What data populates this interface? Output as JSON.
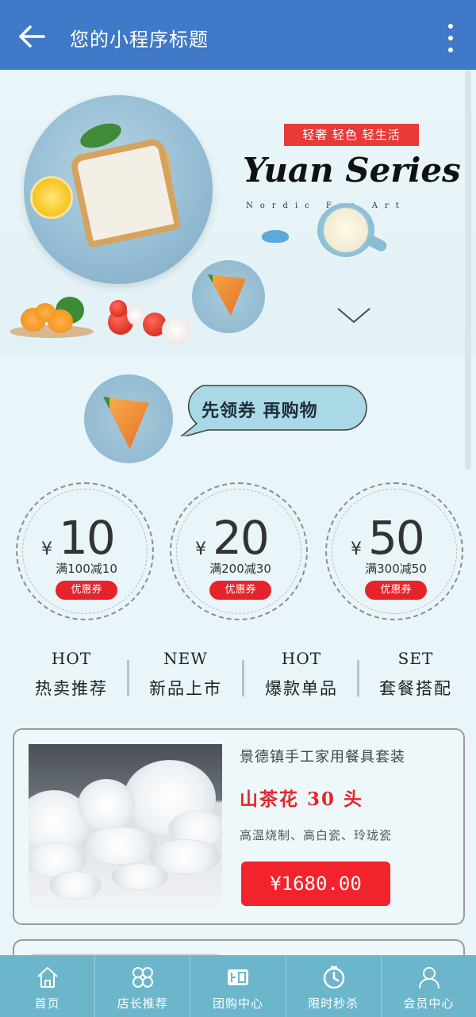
{
  "header": {
    "title": "您的小程序标题",
    "back_icon": "arrow-left-icon",
    "more_icon": "more-vertical-icon",
    "bg_color": "#3f79c8"
  },
  "banner": {
    "tagline": "轻奢 轻色 轻生活",
    "series": "Yuan Series",
    "subtitle": "Nordic   Fan Art"
  },
  "coupon_intro": {
    "text": "先领券 再购物"
  },
  "coupons": [
    {
      "symbol": "¥",
      "amount": "10",
      "condition": "满100减10",
      "label": "优惠券"
    },
    {
      "symbol": "¥",
      "amount": "20",
      "condition": "满200减30",
      "label": "优惠券"
    },
    {
      "symbol": "¥",
      "amount": "50",
      "condition": "满300减50",
      "label": "优惠券"
    }
  ],
  "categories": [
    {
      "en": "HOT",
      "cn": "热卖推荐"
    },
    {
      "en": "NEW",
      "cn": "新品上市"
    },
    {
      "en": "HOT",
      "cn": "爆款单品"
    },
    {
      "en": "SET",
      "cn": "套餐搭配"
    }
  ],
  "product": {
    "name": "景德镇手工家用餐具套装",
    "brand": "山茶花 30 头",
    "desc": "高温烧制、高白瓷、玲珑瓷",
    "price": "¥1680.00"
  },
  "tabbar": {
    "bg_color": "#6cb6cc",
    "items": [
      {
        "label": "首页",
        "icon": "home-icon"
      },
      {
        "label": "店长推荐",
        "icon": "clover-icon"
      },
      {
        "label": "团购中心",
        "icon": "group-buy-icon"
      },
      {
        "label": "限时秒杀",
        "icon": "timer-icon"
      },
      {
        "label": "会员中心",
        "icon": "user-icon"
      }
    ]
  },
  "colors": {
    "accent_red": "#e5232b",
    "page_bg": "#e9f5f8"
  }
}
